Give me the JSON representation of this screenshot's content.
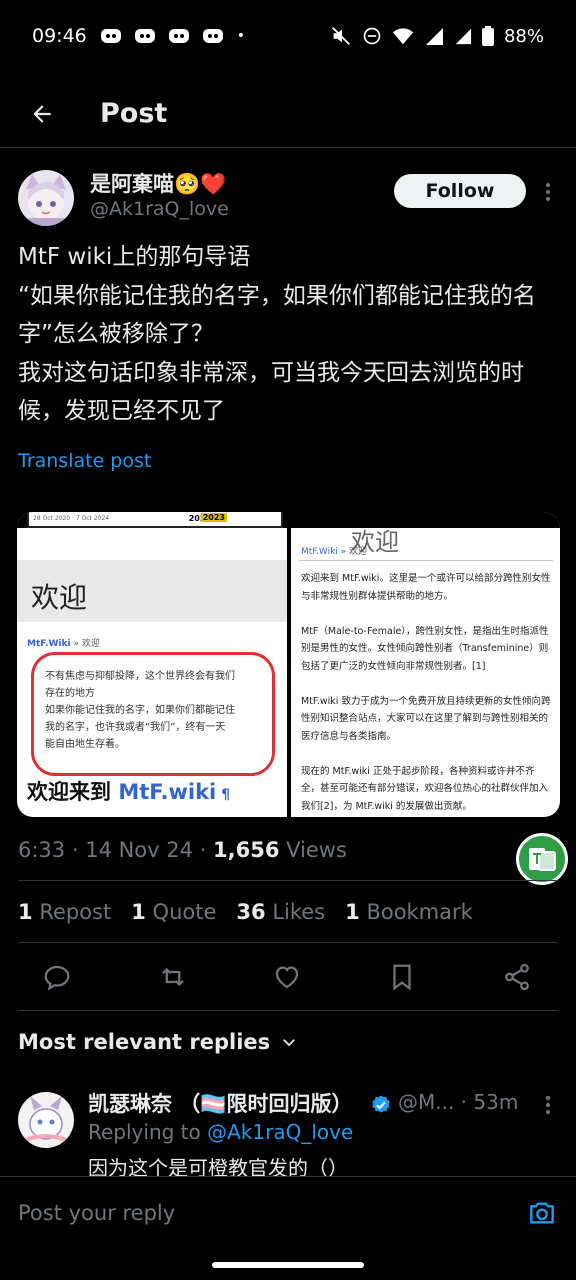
{
  "status_bar": {
    "time": "09:46",
    "battery": "88%",
    "notification_icons": [
      "discord-icon",
      "discord-icon",
      "discord-icon",
      "discord-icon"
    ]
  },
  "header": {
    "title": "Post"
  },
  "post": {
    "author_name": "是阿棄喵🥺❤️",
    "author_handle": "@Ak1raQ_love",
    "follow_label": "Follow",
    "text": "MtF wiki上的那句导语\n“如果你能记住我的名字，如果你们都能记住我的名字”怎么被移除了？\n我对这句话印象非常深，可当我今天回去浏览的时候，发现已经不见了",
    "translate_label": "Translate post",
    "media_left": {
      "wayback_dates": "28 Oct 2020 · 7 Oct 2024",
      "year_prev": "2022",
      "year_current": "2023",
      "heading": "欢迎",
      "crumb_site": "MtF.Wiki",
      "crumb_sep": " » 欢迎",
      "quote": "不有焦虑与抑郁投降，这个世界终会有我们\n存在的地方\n如果你能记住我的名字，如果你们都能记住\n我的名字，也许我或者“我们”，终有一天\n能自由地生存着。",
      "footer_text": "欢迎来到 ",
      "footer_wiki": "MtF.wiki",
      "footer_mark": " ¶"
    },
    "media_right": {
      "heading": "欢迎",
      "crumb_site": "MtF.Wiki",
      "crumb_sep": " » 欢迎",
      "body": "欢迎来到 MtF.wiki。这里是一个或许可以给部分跨性别女性与非常规性别群体提供帮助的地方。\n\nMtF（Male-to-Female），跨性别女性，是指出生时指派性别是男性的女性。女性倾向跨性别者（Transfeminine）则包括了更广泛的女性倾向非常规性别者。[1]\n\nMtF.wiki 致力于成为一个免费开放且持续更新的女性倾向跨性别知识整合站点，大家可以在这里了解到与跨性别相关的医疗信息与各类指南。\n\n现在的 MtF.wiki 正处于起步阶段，各种资料或许并不齐全，甚至可能还有部分错误，欢迎各位热心的社群伙伴加入我们[2]，为 MtF.wiki 的发展做出贡献。"
    },
    "time": "6:33",
    "date": "14 Nov 24",
    "views_count": "1,656",
    "views_label": "Views",
    "stats": [
      {
        "count": "1",
        "label": "Repost"
      },
      {
        "count": "1",
        "label": "Quote"
      },
      {
        "count": "36",
        "label": "Likes"
      },
      {
        "count": "1",
        "label": "Bookmark"
      }
    ]
  },
  "replies": {
    "header": "Most relevant replies",
    "items": [
      {
        "name": "凯瑟琳奈 （🏳️‍⚧️限时回归版）",
        "handle": "@M...",
        "time": "53m",
        "replying_to_label": "Replying to ",
        "replying_to_handle": "@Ak1raQ_love",
        "text": "因为这个是可橙教官发的（）"
      }
    ]
  },
  "reply_bar": {
    "placeholder": "Post your reply"
  },
  "colors": {
    "accent": "#1d9bf0",
    "background": "#000000",
    "muted": "#71767b",
    "text": "#e7e9ea"
  }
}
